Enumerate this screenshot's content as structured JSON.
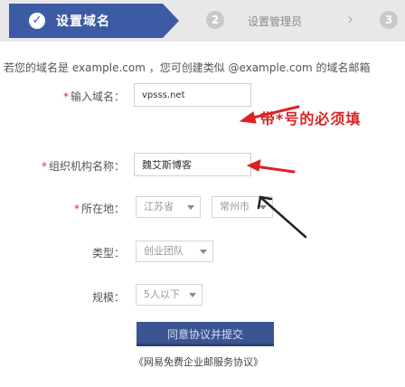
{
  "steps": [
    {
      "number": "✓",
      "label": "设置域名",
      "active": true
    },
    {
      "number": "2",
      "label": "设置管理员",
      "active": false
    },
    {
      "number": "3",
      "label": "",
      "active": false
    }
  ],
  "intro_text": "若您的域名是 example.com ，您可创建类似 @example.com 的域名邮箱",
  "form": {
    "domain": {
      "label": "输入域名：",
      "required": true,
      "value": "vpsss.net"
    },
    "org_name": {
      "label": "组织机构名称：",
      "required": true,
      "value": "魏艾斯博客"
    },
    "location": {
      "label": "所在地：",
      "required": true,
      "province": "江苏省",
      "city": "常州市"
    },
    "type": {
      "label": "类型：",
      "required": false,
      "value": "创业团队"
    },
    "scale": {
      "label": "规模：",
      "required": false,
      "value": "5人以下"
    }
  },
  "annotation": {
    "text": "带*号的必须填",
    "color": "#dd2222"
  },
  "submit_label": "同意协议并提交",
  "agreement_link": "《网易免费企业邮服务协议》",
  "colors": {
    "accent": "#3d5ba5",
    "required_star": "#d9332e",
    "button": "#3b5593"
  }
}
